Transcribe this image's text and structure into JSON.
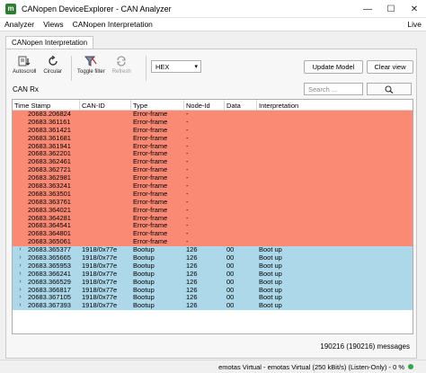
{
  "window": {
    "title": "CANopen DeviceExplorer - CAN Analyzer",
    "icon_letter": "m",
    "minimize": "—",
    "maximize": "☐",
    "close": "✕"
  },
  "menu": {
    "analyzer": "Analyzer",
    "views": "Views",
    "interp": "CANopen Interpretation",
    "live": "Live"
  },
  "tab": {
    "label": "CANopen Interpretation"
  },
  "toolbar": {
    "autoscroll": "Autoscroll",
    "circular": "Circular",
    "toggle_filter": "Toggle filter",
    "refresh": "Refresh",
    "format": "HEX",
    "update_model": "Update Model",
    "clear_view": "Clear view"
  },
  "canrx": {
    "label": "CAN Rx",
    "search_placeholder": "Search ..."
  },
  "table": {
    "headers": [
      "Time Stamp",
      "CAN-ID",
      "Type",
      "Node-Id",
      "Data",
      "Interpretation"
    ],
    "rows": [
      {
        "ts": "20683.206824",
        "id": "",
        "type": "Error-frame",
        "node": "-",
        "data": "",
        "interp": "",
        "kind": "err"
      },
      {
        "ts": "20683.361161",
        "id": "",
        "type": "Error-frame",
        "node": "-",
        "data": "",
        "interp": "",
        "kind": "err"
      },
      {
        "ts": "20683.361421",
        "id": "",
        "type": "Error-frame",
        "node": "-",
        "data": "",
        "interp": "",
        "kind": "err"
      },
      {
        "ts": "20683.361681",
        "id": "",
        "type": "Error-frame",
        "node": "-",
        "data": "",
        "interp": "",
        "kind": "err"
      },
      {
        "ts": "20683.361941",
        "id": "",
        "type": "Error-frame",
        "node": "-",
        "data": "",
        "interp": "",
        "kind": "err"
      },
      {
        "ts": "20683.362201",
        "id": "",
        "type": "Error-frame",
        "node": "-",
        "data": "",
        "interp": "",
        "kind": "err"
      },
      {
        "ts": "20683.362461",
        "id": "",
        "type": "Error-frame",
        "node": "-",
        "data": "",
        "interp": "",
        "kind": "err"
      },
      {
        "ts": "20683.362721",
        "id": "",
        "type": "Error-frame",
        "node": "-",
        "data": "",
        "interp": "",
        "kind": "err"
      },
      {
        "ts": "20683.362981",
        "id": "",
        "type": "Error-frame",
        "node": "-",
        "data": "",
        "interp": "",
        "kind": "err"
      },
      {
        "ts": "20683.363241",
        "id": "",
        "type": "Error-frame",
        "node": "-",
        "data": "",
        "interp": "",
        "kind": "err"
      },
      {
        "ts": "20683.363501",
        "id": "",
        "type": "Error-frame",
        "node": "-",
        "data": "",
        "interp": "",
        "kind": "err"
      },
      {
        "ts": "20683.363761",
        "id": "",
        "type": "Error-frame",
        "node": "-",
        "data": "",
        "interp": "",
        "kind": "err"
      },
      {
        "ts": "20683.364021",
        "id": "",
        "type": "Error-frame",
        "node": "-",
        "data": "",
        "interp": "",
        "kind": "err"
      },
      {
        "ts": "20683.364281",
        "id": "",
        "type": "Error-frame",
        "node": "-",
        "data": "",
        "interp": "",
        "kind": "err"
      },
      {
        "ts": "20683.364541",
        "id": "",
        "type": "Error-frame",
        "node": "-",
        "data": "",
        "interp": "",
        "kind": "err"
      },
      {
        "ts": "20683.364801",
        "id": "",
        "type": "Error-frame",
        "node": "-",
        "data": "",
        "interp": "",
        "kind": "err"
      },
      {
        "ts": "20683.365061",
        "id": "",
        "type": "Error-frame",
        "node": "-",
        "data": "",
        "interp": "",
        "kind": "err"
      },
      {
        "ts": "20683.365377",
        "id": "1918/0x77e",
        "type": "Bootup",
        "node": "126",
        "data": "00",
        "interp": "Boot up",
        "kind": "boot"
      },
      {
        "ts": "20683.365665",
        "id": "1918/0x77e",
        "type": "Bootup",
        "node": "126",
        "data": "00",
        "interp": "Boot up",
        "kind": "boot"
      },
      {
        "ts": "20683.365953",
        "id": "1918/0x77e",
        "type": "Bootup",
        "node": "126",
        "data": "00",
        "interp": "Boot up",
        "kind": "boot"
      },
      {
        "ts": "20683.366241",
        "id": "1918/0x77e",
        "type": "Bootup",
        "node": "126",
        "data": "00",
        "interp": "Boot up",
        "kind": "boot"
      },
      {
        "ts": "20683.366529",
        "id": "1918/0x77e",
        "type": "Bootup",
        "node": "126",
        "data": "00",
        "interp": "Boot up",
        "kind": "boot"
      },
      {
        "ts": "20683.366817",
        "id": "1918/0x77e",
        "type": "Bootup",
        "node": "126",
        "data": "00",
        "interp": "Boot up",
        "kind": "boot"
      },
      {
        "ts": "20683.367105",
        "id": "1918/0x77e",
        "type": "Bootup",
        "node": "126",
        "data": "00",
        "interp": "Boot up",
        "kind": "boot"
      },
      {
        "ts": "20683.367393",
        "id": "1918/0x77e",
        "type": "Bootup",
        "node": "126",
        "data": "00",
        "interp": "Boot up",
        "kind": "boot"
      }
    ]
  },
  "footer": {
    "message_count": "190216 (190216) messages",
    "status": "emotas Virtual - emotas Virtual (250 kBit/s) (Listen-Only) - 0 %"
  },
  "colors": {
    "error_row": "#fa8a74",
    "bootup_row": "#add8ea",
    "status_ok": "#2aa84a"
  }
}
